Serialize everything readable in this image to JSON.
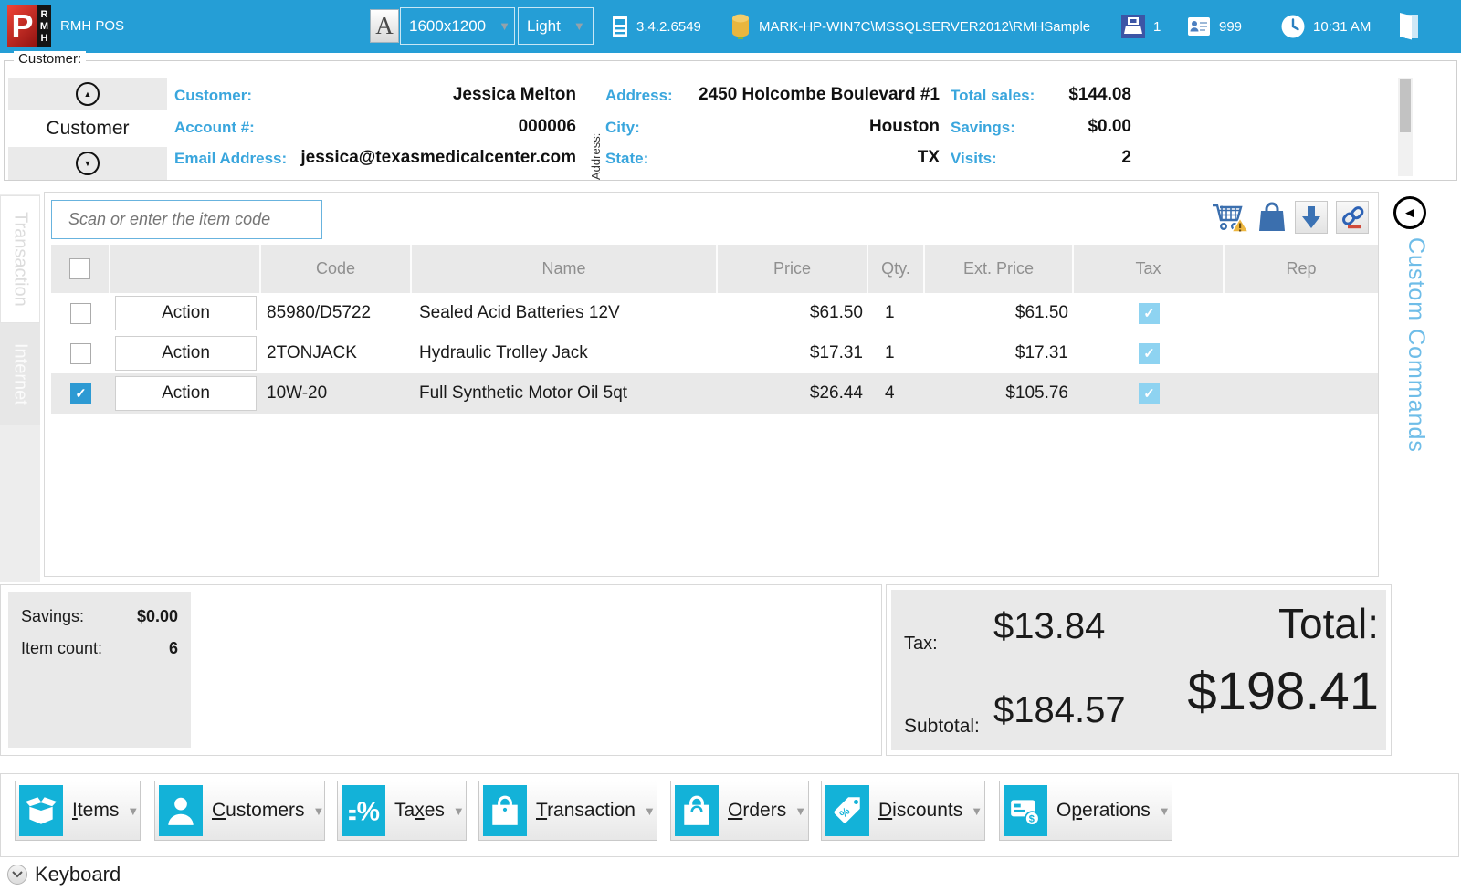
{
  "colors": {
    "titlebar_bg": "#259ed6",
    "accent_blue": "#3aa6dd",
    "icon_cyan": "#13b2d8",
    "tax_check_bg": "#8ed3f1",
    "selected_check_bg": "#2d9ad3",
    "panel_gray": "#e9e9e9",
    "logo_red": "#c4271d"
  },
  "titlebar": {
    "logo_letter": "P",
    "logo_stack": "RMH",
    "app_title": "RMH POS",
    "font_button_label": "A",
    "resolution_value": "1600x1200",
    "theme_value": "Light",
    "version": "3.4.2.6549",
    "database": "MARK-HP-WIN7C\\MSSQLSERVER2012\\RMHSample",
    "register_number": "1",
    "cashier_number": "999",
    "time": "10:31 AM"
  },
  "customer_panel": {
    "group_label": "Customer:",
    "nav_label": "Customer",
    "customer_label": "Customer:",
    "customer_value": "Jessica Melton",
    "account_label": "Account #:",
    "account_value": "000006",
    "email_label": "Email Address:",
    "email_value": "jessica@texasmedicalcenter.com",
    "address_group_label": "Address:",
    "address_label": "Address:",
    "address_value": "2450 Holcombe Boulevard #1",
    "city_label": "City:",
    "city_value": "Houston",
    "state_label": "State:",
    "state_value": "TX",
    "total_sales_label": "Total sales:",
    "total_sales_value": "$144.08",
    "savings_label": "Savings:",
    "savings_value": "$0.00",
    "visits_label": "Visits:",
    "visits_value": "2"
  },
  "side_tabs": {
    "transaction_label": "Transaction",
    "internet_label": "Internet"
  },
  "custom_commands_label": "Custom Commands",
  "transaction": {
    "scan_placeholder": "Scan or enter the item code",
    "action_label": "Action",
    "columns": {
      "code": "Code",
      "name": "Name",
      "price": "Price",
      "qty": "Qty.",
      "ext_price": "Ext. Price",
      "tax": "Tax",
      "rep": "Rep"
    },
    "check_glyph": "✓",
    "rows": [
      {
        "selected": false,
        "code": "85980/D5722",
        "name": "Sealed Acid Batteries 12V",
        "price": "$61.50",
        "qty": "1",
        "ext_price": "$61.50",
        "tax": true,
        "rep": ""
      },
      {
        "selected": false,
        "code": "2TONJACK",
        "name": "Hydraulic Trolley Jack",
        "price": "$17.31",
        "qty": "1",
        "ext_price": "$17.31",
        "tax": true,
        "rep": ""
      },
      {
        "selected": true,
        "code": "10W-20",
        "name": "Full Synthetic Motor Oil 5qt",
        "price": "$26.44",
        "qty": "4",
        "ext_price": "$105.76",
        "tax": true,
        "rep": ""
      }
    ]
  },
  "summary": {
    "savings_label": "Savings:",
    "savings_value": "$0.00",
    "item_count_label": "Item count:",
    "item_count_value": "6"
  },
  "totals": {
    "tax_label": "Tax:",
    "tax_value": "$13.84",
    "subtotal_label": "Subtotal:",
    "subtotal_value": "$184.57",
    "total_label": "Total:",
    "total_value": "$198.41"
  },
  "action_buttons": [
    {
      "icon": "open-box-icon",
      "pre": "",
      "key": "I",
      "post": "tems"
    },
    {
      "icon": "person-icon",
      "pre": "",
      "key": "C",
      "post": "ustomers"
    },
    {
      "icon": "percent-icon",
      "pre": "Ta",
      "key": "x",
      "post": "es"
    },
    {
      "icon": "shopping-bag-icon",
      "pre": "",
      "key": "T",
      "post": "ransaction"
    },
    {
      "icon": "shopping-bag-icon",
      "pre": "",
      "key": "O",
      "post": "rders"
    },
    {
      "icon": "price-tag-icon",
      "pre": "",
      "key": "D",
      "post": "iscounts"
    },
    {
      "icon": "card-coins-icon",
      "pre": "O",
      "key": "p",
      "post": "erations"
    }
  ],
  "keyboard_label": "Keyboard"
}
